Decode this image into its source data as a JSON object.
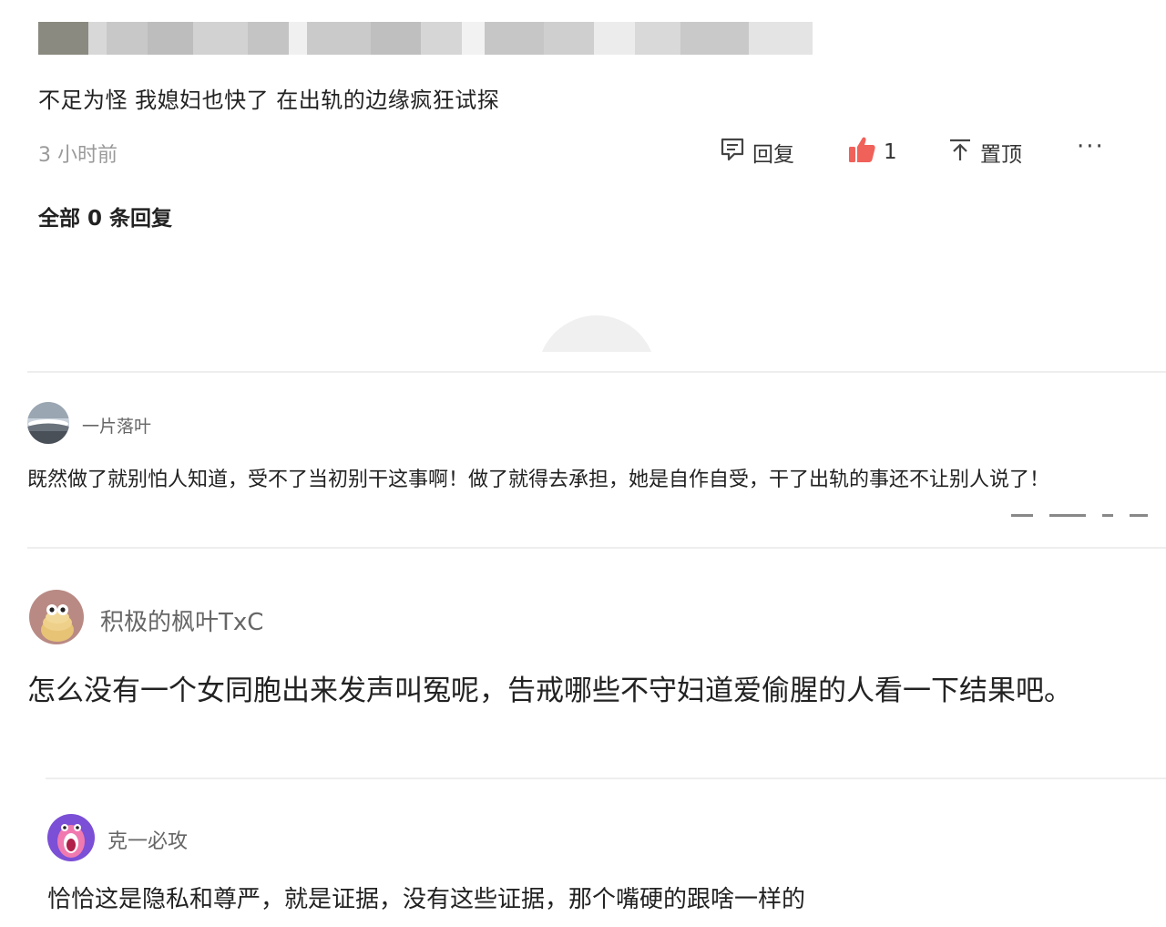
{
  "top_comment": {
    "text": "不足为怪 我媳妇也快了 在出轨的边缘疯狂试探",
    "time": "3 小时前",
    "actions": {
      "reply_label": "回复",
      "like_count": "1",
      "pin_label": "置顶",
      "more_label": "···"
    },
    "replies_summary": "全部 0 条回复"
  },
  "comments": [
    {
      "username": "一片落叶",
      "text": "既然做了就别怕人知道，受不了当初别干这事啊！做了就得去承担，她是自作自受，干了出轨的事还不让别人说了！"
    },
    {
      "username": "积极的枫叶TxC",
      "text": "怎么没有一个女同胞出来发声叫冤呢，告戒哪些不守妇道爱偷腥的人看一下结果吧。"
    },
    {
      "username": "克一必攻",
      "text": "恰恰这是隐私和尊严，就是证据，没有这些证据，那个嘴硬的跟啥一样的"
    }
  ],
  "colors": {
    "like": "#f0615a",
    "muted": "#9a9a9a",
    "divider": "#eeeeee"
  }
}
